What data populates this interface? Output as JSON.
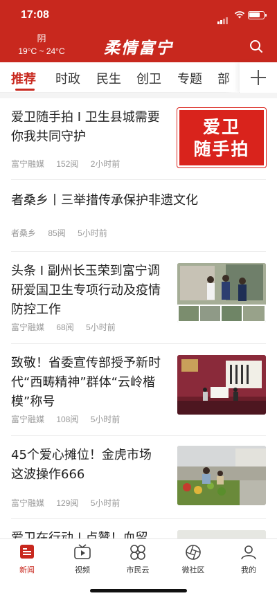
{
  "status_bar": {
    "time": "17:08"
  },
  "header": {
    "weather_condition": "阴",
    "weather_temp": "19°C ~ 24°C",
    "logo_text": "柔情富宁",
    "search_icon": "search-icon"
  },
  "tabs": [
    {
      "label": "推荐",
      "active": true
    },
    {
      "label": "时政"
    },
    {
      "label": "民生"
    },
    {
      "label": "创卫"
    },
    {
      "label": "专题"
    },
    {
      "label": "部"
    }
  ],
  "articles": [
    {
      "title": "爱卫随手拍 I 卫生县城需要你我共同守护",
      "source": "富宁融媒",
      "views": "152阅",
      "time": "2小时前",
      "thumb_text": "爱卫\n随手拍",
      "thumb_type": "banner"
    },
    {
      "title": "者桑乡丨三举措传承保护非遗文化",
      "source": "者桑乡",
      "views": "85阅",
      "time": "5小时前"
    },
    {
      "title": "头条 I 副州长玉荣到富宁调研爱国卫生专项行动及疫情防控工作",
      "source": "富宁融媒",
      "views": "68阅",
      "time": "5小时前",
      "thumb_type": "photo-meeting"
    },
    {
      "title": "致敬！省委宣传部授予新时代“西畴精神”群体“云岭楷模”称号",
      "source": "富宁融媒",
      "views": "108阅",
      "time": "5小时前",
      "thumb_type": "photo-stage"
    },
    {
      "title": "45个爱心摊位！金虎市场这波操作666",
      "source": "富宁融媒",
      "views": "129阅",
      "time": "5小时前",
      "thumb_type": "photo-market"
    },
    {
      "title": "爱卫在行动 | 点赞！血留",
      "thumb_type": "photo-partial"
    }
  ],
  "bottom_nav": [
    {
      "label": "新闻",
      "icon": "news-icon",
      "active": true
    },
    {
      "label": "视频",
      "icon": "tv-icon"
    },
    {
      "label": "市民云",
      "icon": "grid-flower-icon"
    },
    {
      "label": "微社区",
      "icon": "aperture-icon"
    },
    {
      "label": "我的",
      "icon": "person-icon"
    }
  ],
  "colors": {
    "brand_red": "#c8281e",
    "text": "#222222",
    "meta": "#999999"
  }
}
